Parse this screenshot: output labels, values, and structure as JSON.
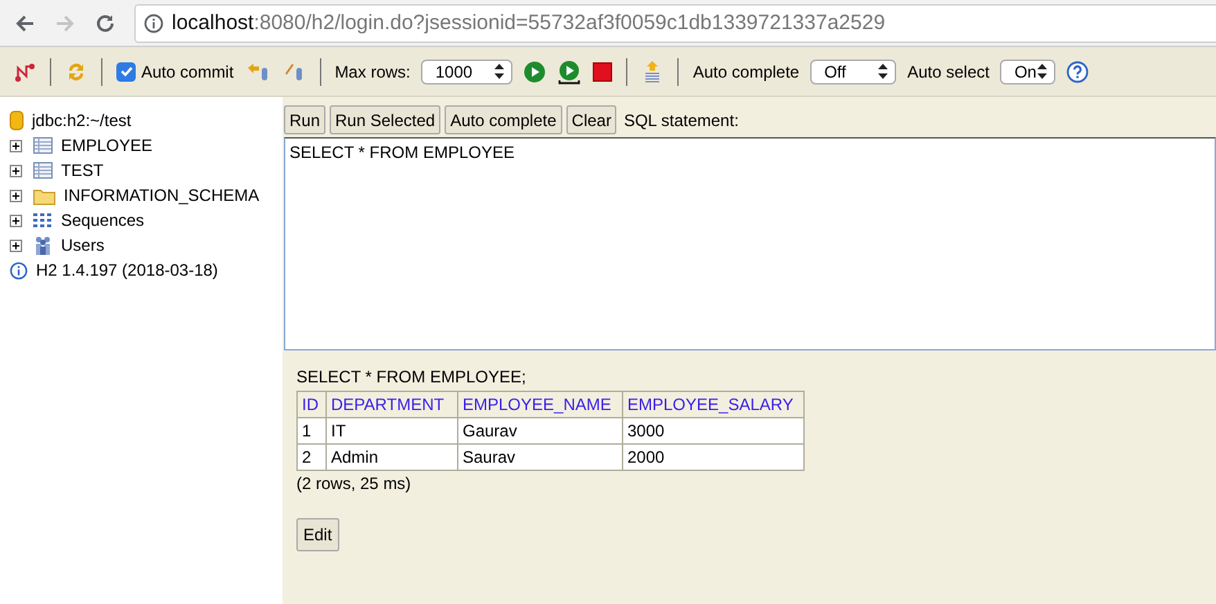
{
  "browser": {
    "url_host": "localhost",
    "url_path": ":8080/h2/login.do?jsessionid=55732af3f0059c1db1339721337a2529"
  },
  "toolbar": {
    "auto_commit": {
      "label": "Auto commit",
      "checked": true
    },
    "max_rows": {
      "label": "Max rows:",
      "value": "1000"
    },
    "auto_complete": {
      "label": "Auto complete",
      "value": "Off"
    },
    "auto_select": {
      "label": "Auto select",
      "value": "On"
    }
  },
  "tree": [
    {
      "kind": "database",
      "label": "jdbc:h2:~/test",
      "expandable": false
    },
    {
      "kind": "table",
      "label": "EMPLOYEE",
      "expandable": true
    },
    {
      "kind": "table",
      "label": "TEST",
      "expandable": true
    },
    {
      "kind": "folder",
      "label": "INFORMATION_SCHEMA",
      "expandable": true
    },
    {
      "kind": "sequences",
      "label": "Sequences",
      "expandable": true
    },
    {
      "kind": "users",
      "label": "Users",
      "expandable": true
    },
    {
      "kind": "info",
      "label": "H2 1.4.197 (2018-03-18)",
      "expandable": false
    }
  ],
  "query_buttons": [
    "Run",
    "Run Selected",
    "Auto complete",
    "Clear"
  ],
  "query_label": "SQL statement:",
  "query_text": "SELECT * FROM EMPLOYEE",
  "result": {
    "statement": "SELECT * FROM EMPLOYEE;",
    "columns": [
      "ID",
      "DEPARTMENT",
      "EMPLOYEE_NAME",
      "EMPLOYEE_SALARY"
    ],
    "rows": [
      [
        "1",
        "IT",
        "Gaurav",
        "3000"
      ],
      [
        "2",
        "Admin",
        "Saurav",
        "2000"
      ]
    ],
    "summary": "(2 rows, 25 ms)",
    "edit_button": "Edit"
  }
}
